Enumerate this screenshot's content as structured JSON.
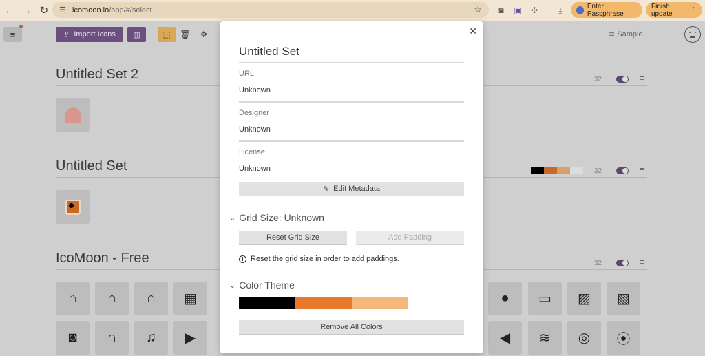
{
  "browser": {
    "url_domain": "icomoon.io",
    "url_path": "/app/#/select",
    "passphrase_label": "Enter Passphrase",
    "update_label": "Finish update"
  },
  "toolbar": {
    "import_label": "Import Icons",
    "sample_label": "Sample"
  },
  "sets": [
    {
      "title": "Untitled Set 2",
      "count": "32"
    },
    {
      "title": "Untitled Set",
      "count": "32",
      "swatches": [
        "#000000",
        "#d9742f",
        "#e7b075",
        "#dddddd"
      ]
    },
    {
      "title": "IcoMoon - Free",
      "count": "32"
    }
  ],
  "modal": {
    "title": "Untitled Set",
    "url_label": "URL",
    "url_value": "Unknown",
    "designer_label": "Designer",
    "designer_value": "Unknown",
    "license_label": "License",
    "license_value": "Unknown",
    "edit_metadata_label": "Edit Metadata",
    "grid_heading": "Grid Size: Unknown",
    "reset_grid_label": "Reset Grid Size",
    "add_padding_label": "Add Padding",
    "grid_info": "Reset the grid size in order to add paddings.",
    "color_heading": "Color Theme",
    "theme_colors": [
      "#000000",
      "#e8792f",
      "#f4b97a"
    ],
    "remove_colors_label": "Remove All Colors"
  },
  "colors": {
    "accent": "#6b4f7e",
    "tool_active": "#d9a857",
    "update_pill": "#f2b86b"
  }
}
